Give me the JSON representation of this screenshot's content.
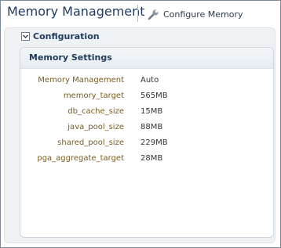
{
  "header": {
    "title": "Memory Management",
    "configure_label": "Configure Memory"
  },
  "section": {
    "title": "Configuration"
  },
  "memory_settings": {
    "title": "Memory Settings",
    "rows": [
      {
        "label": "Memory Management",
        "value": "Auto"
      },
      {
        "label": "memory_target",
        "value": "565MB"
      },
      {
        "label": "db_cache_size",
        "value": "15MB"
      },
      {
        "label": "java_pool_size",
        "value": "88MB"
      },
      {
        "label": "shared_pool_size",
        "value": "229MB"
      },
      {
        "label": "pga_aggregate_target",
        "value": "28MB"
      }
    ]
  },
  "icons": {
    "configure": "wrench-icon",
    "disclosure": "chevron-down-icon"
  }
}
